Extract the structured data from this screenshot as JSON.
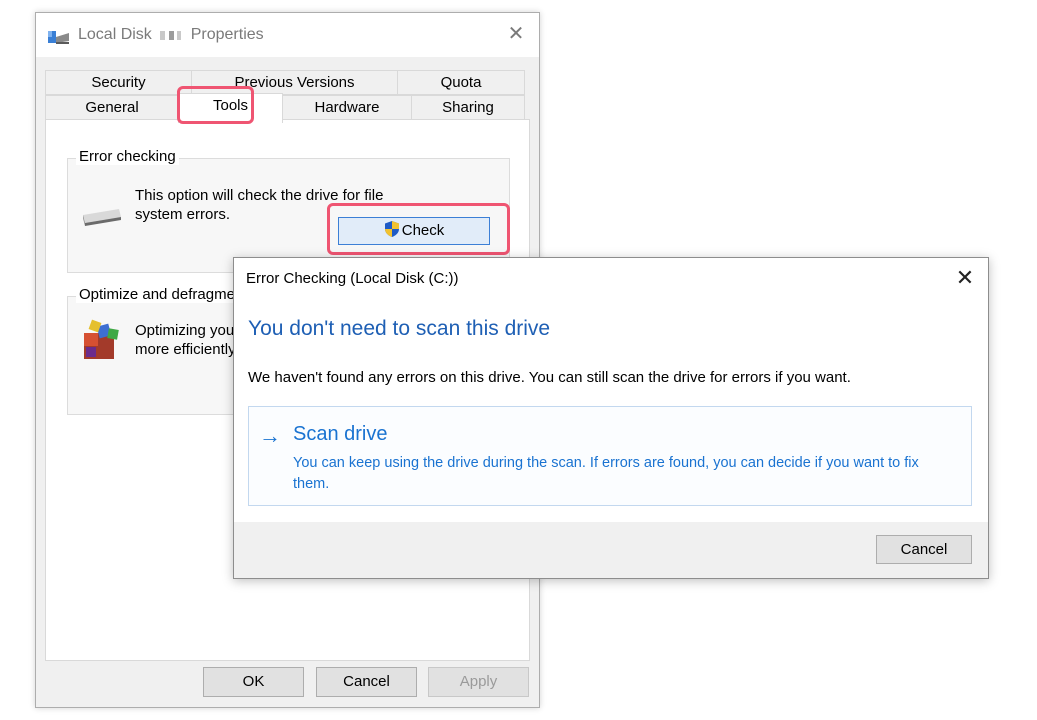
{
  "properties": {
    "title_prefix": "Local Disk",
    "title_suffix": "Properties",
    "tabs_row1": [
      "Security",
      "Previous Versions",
      "Quota"
    ],
    "tabs_row2": [
      "General",
      "Tools",
      "Hardware",
      "Sharing"
    ],
    "error_checking": {
      "label": "Error checking",
      "text_line1": "This option will check the drive for file",
      "text_line2": "system errors.",
      "check_label": "Check"
    },
    "optimize": {
      "label": "Optimize and defragment drive",
      "text_line1": "Optimizing your",
      "text_line2": "more efficiently"
    },
    "buttons": {
      "ok": "OK",
      "cancel": "Cancel",
      "apply": "Apply"
    }
  },
  "error_dialog": {
    "title": "Error Checking (Local Disk (C:))",
    "heading": "You don't need to scan this drive",
    "description": "We haven't found any errors on this drive. You can still scan the drive for errors if you want.",
    "scan_option": {
      "arrow": "→",
      "title": "Scan drive",
      "description": "You can keep using the drive during the scan. If errors are found, you can decide if you want to fix them."
    },
    "cancel_label": "Cancel"
  },
  "colors": {
    "highlight": "#ef5572",
    "link_blue": "#1a73d1",
    "heading_blue": "#1e5fb4"
  }
}
